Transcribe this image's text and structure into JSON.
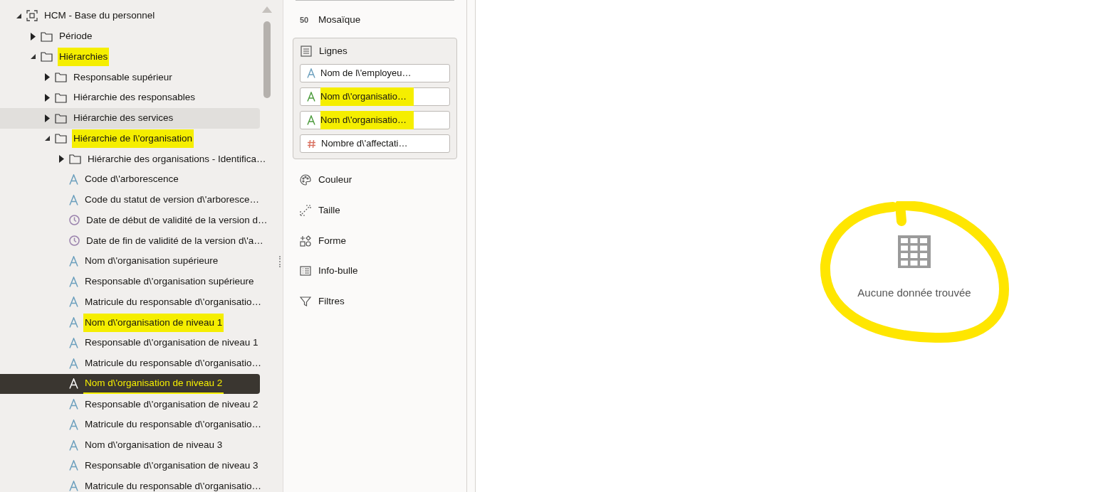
{
  "tree": [
    {
      "label": "HCM - Base du personnel",
      "kind": "dataset",
      "expanded": true,
      "selected": false,
      "hovered": false,
      "highlighted": false,
      "children": [
        {
          "label": "Période",
          "kind": "folder",
          "expanded": false,
          "selected": false,
          "hovered": false,
          "highlighted": false
        },
        {
          "label": "Hiérarchies",
          "kind": "folder",
          "expanded": true,
          "selected": false,
          "hovered": false,
          "highlighted": true,
          "children": [
            {
              "label": "Responsable supérieur",
              "kind": "folder",
              "expanded": false,
              "selected": false,
              "hovered": false,
              "highlighted": false
            },
            {
              "label": "Hiérarchie des responsables",
              "kind": "folder",
              "expanded": false,
              "selected": false,
              "hovered": false,
              "highlighted": false
            },
            {
              "label": "Hiérarchie des services",
              "kind": "folder",
              "expanded": false,
              "selected": false,
              "hovered": true,
              "highlighted": false
            },
            {
              "label": "Hiérarchie de l\\'organisation",
              "kind": "folder",
              "expanded": true,
              "selected": false,
              "hovered": false,
              "highlighted": true,
              "children": [
                {
                  "label": "Hiérarchie des organisations - Identifica…",
                  "kind": "folder",
                  "expanded": false,
                  "selected": false,
                  "hovered": false,
                  "highlighted": false
                },
                {
                  "label": "Code d\\'arborescence",
                  "kind": "text",
                  "selected": false,
                  "hovered": false,
                  "highlighted": false
                },
                {
                  "label": "Code du statut de version d\\'arboresce…",
                  "kind": "text",
                  "selected": false,
                  "hovered": false,
                  "highlighted": false
                },
                {
                  "label": "Date de début de validité de la version d…",
                  "kind": "date",
                  "selected": false,
                  "hovered": false,
                  "highlighted": false
                },
                {
                  "label": "Date de fin de validité de la version d\\'a…",
                  "kind": "date",
                  "selected": false,
                  "hovered": false,
                  "highlighted": false
                },
                {
                  "label": "Nom d\\'organisation supérieure",
                  "kind": "text",
                  "selected": false,
                  "hovered": false,
                  "highlighted": false
                },
                {
                  "label": "Responsable d\\'organisation supérieure",
                  "kind": "text",
                  "selected": false,
                  "hovered": false,
                  "highlighted": false
                },
                {
                  "label": "Matricule du responsable d\\'organisatio…",
                  "kind": "text",
                  "selected": false,
                  "hovered": false,
                  "highlighted": false
                },
                {
                  "label": "Nom d\\'organisation de niveau 1",
                  "kind": "text",
                  "selected": false,
                  "hovered": false,
                  "highlighted": true
                },
                {
                  "label": "Responsable d\\'organisation de niveau 1",
                  "kind": "text",
                  "selected": false,
                  "hovered": false,
                  "highlighted": false
                },
                {
                  "label": "Matricule du responsable d\\'organisatio…",
                  "kind": "text",
                  "selected": false,
                  "hovered": false,
                  "highlighted": false
                },
                {
                  "label": "Nom d\\'organisation de niveau 2",
                  "kind": "text",
                  "selected": true,
                  "hovered": false,
                  "highlighted": true
                },
                {
                  "label": "Responsable d\\'organisation de niveau 2",
                  "kind": "text",
                  "selected": false,
                  "hovered": false,
                  "highlighted": false
                },
                {
                  "label": "Matricule du responsable d\\'organisatio…",
                  "kind": "text",
                  "selected": false,
                  "hovered": false,
                  "highlighted": false
                },
                {
                  "label": "Nom d\\'organisation de niveau 3",
                  "kind": "text",
                  "selected": false,
                  "hovered": false,
                  "highlighted": false
                },
                {
                  "label": "Responsable d\\'organisation de niveau 3",
                  "kind": "text",
                  "selected": false,
                  "hovered": false,
                  "highlighted": false
                },
                {
                  "label": "Matricule du responsable d\\'organisatio…",
                  "kind": "text",
                  "selected": false,
                  "hovered": false,
                  "highlighted": false
                }
              ]
            }
          ]
        }
      ]
    }
  ],
  "grammar": {
    "mosaic": {
      "glyph": "50",
      "label": "Mosaïque"
    },
    "rows": {
      "label": "Lignes",
      "chips": [
        {
          "label": "Nom de l\\'employeu…",
          "kind": "text",
          "highlighted": false
        },
        {
          "label": "Nom d\\'organisatio…",
          "kind": "text",
          "highlighted": true
        },
        {
          "label": "Nom d\\'organisatio…",
          "kind": "text",
          "highlighted": true
        },
        {
          "label": "Nombre d\\'affectati…",
          "kind": "number",
          "highlighted": false
        }
      ]
    },
    "sections": [
      {
        "label": "Couleur",
        "kind": "color"
      },
      {
        "label": "Taille",
        "kind": "size"
      },
      {
        "label": "Forme",
        "kind": "shape"
      },
      {
        "label": "Info-bulle",
        "kind": "tooltip"
      },
      {
        "label": "Filtres",
        "kind": "filter"
      }
    ]
  },
  "canvas": {
    "empty_message": "Aucune donnée trouvée",
    "highlighted": true
  }
}
